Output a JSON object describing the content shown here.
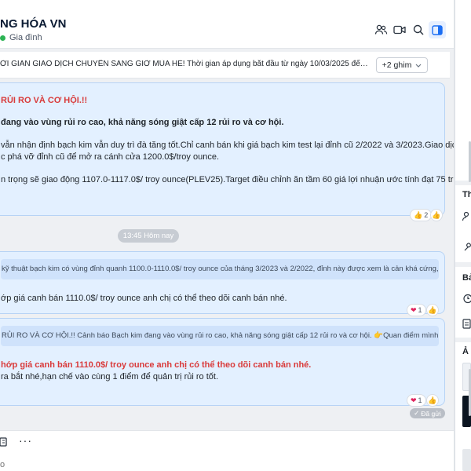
{
  "header": {
    "title": "NG HÓA VN",
    "subtitle": "Gia đình",
    "icons": [
      "group-icon",
      "video-call-icon",
      "search-icon",
      "sidebar-toggle-icon"
    ]
  },
  "pinned": {
    "text": "ỜI GIAN GIAO DỊCH CHUYỂN SANG GIỜ MÙA HÈ! Thời gian áp dụng bắt đầu từ ngày 10/03/2025 đến ngày 28/03/2025...",
    "more_label": "+2 ghim"
  },
  "messages": {
    "m1": {
      "heading": "RỦI RO VÀ CƠ HỘI.!!",
      "bold_line": "đang vào vùng rủi ro cao, khả năng sóng giật cấp 12 rủi ro và cơ hội.",
      "line1": "vẫn nhận định bạch kim vẫn duy trì đà tăng tốt.Chỉ canh bán khi giá bạch kim test lại đỉnh cũ 2/2022 và 3/2023.Giao dịch",
      "line2": "c phá vỡ đỉnh cũ để mở ra cánh cửa 1200.0$/troy ounce.",
      "line3": "n trọng sẽ giao động 1107.0-1117.0$/ troy ounce(PLEV25).Target điều chỉnh ăn tầm 60 giá lợi nhuận ước tính đạt 75 triệu cho 1",
      "reaction_count": "2"
    },
    "time_separator": "13:45 Hôm nay",
    "m2": {
      "quote": "kỹ thuật bạch kim có vùng đỉnh quanh 1100.0-1110.0$/ troy ounce của tháng 3/2023 và 2/2022, đỉnh này được xem là cản khá cứng, do vậy a...",
      "line1": "ớp giá canh bán 1110.0$/ troy ounce anh chị có thể theo dõi canh bán nhé.",
      "reaction_count": "1"
    },
    "m3": {
      "quote": "RỦI RO VÀ CƠ HỘI.!! Cảnh báo Bạch kim đang vào vùng rủi ro cao, khả năng sóng giật cấp 12 rủi ro và cơ hội. 👉Quan điểm mình vẫn nhận địn...",
      "line1": "hớp giá canh bán 1110.0$/ troy ounce anh chị có thể theo dõi canh bán nhé.",
      "line2": "ra bắt nhé,hạn chế vào cùng 1 điểm để quản trị rủi ro tốt.",
      "reaction_count": "1",
      "sent_label": "Đã gửi"
    }
  },
  "composer": {
    "more_label": "···",
    "placeholder": "o"
  },
  "right_panel": {
    "section1": "Th",
    "section2": "Bả",
    "section3": "Ả"
  },
  "colors": {
    "bubble_bg": "#e3f0ff",
    "bubble_border": "#b7d3f5",
    "alert_red": "#d93a3a",
    "online_green": "#2cb353",
    "accent_blue": "#1b6ef3"
  }
}
